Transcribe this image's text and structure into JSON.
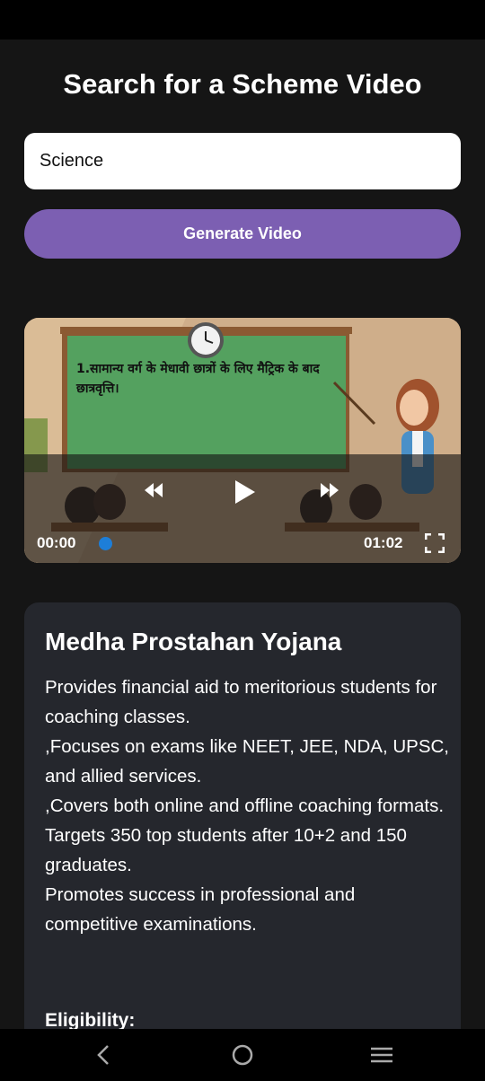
{
  "header": {
    "title": "Search for a Scheme Video"
  },
  "search": {
    "value": "Science"
  },
  "actions": {
    "generate_label": "Generate Video"
  },
  "video": {
    "board_text": "1.सामान्य वर्ग के मेधावी छात्रों के लिए मैट्रिक के बाद छात्रवृत्ति।",
    "current_time": "00:00",
    "total_time": "01:02",
    "progress": 0
  },
  "scheme": {
    "title": "Medha Prostahan Yojana",
    "description": "Provides financial aid to meritorious students for coaching classes.\n,Focuses on exams like NEET, JEE, NDA, UPSC, and allied services.\n,Covers both online and offline coaching formats.\nTargets 350 top students after 10+2 and 150 graduates.\nPromotes success in professional and competitive examinations.",
    "eligibility_heading": "Eligibility:"
  },
  "colors": {
    "background": "#151515",
    "accent": "#7c5fb2",
    "card": "#25272d",
    "seek": "#1d7ed8"
  },
  "icons": [
    "rewind-icon",
    "play-icon",
    "fast-forward-icon",
    "fullscreen-icon",
    "back-icon",
    "home-icon",
    "recents-icon"
  ]
}
